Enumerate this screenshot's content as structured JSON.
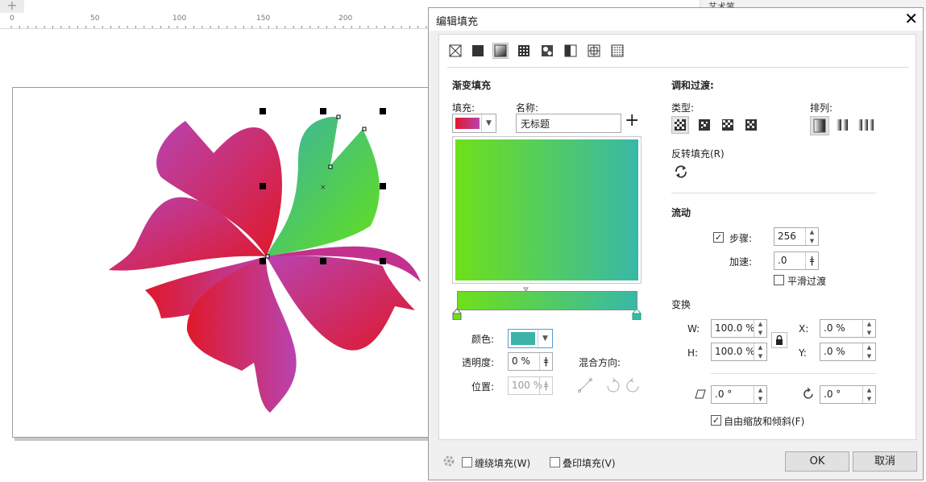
{
  "ruler": {
    "plus": "+",
    "ticks": [
      "0",
      "50",
      "100",
      "150",
      "200"
    ]
  },
  "right_strip": {
    "label": "艺术笔"
  },
  "dialog": {
    "title": "编辑填充",
    "close": "✕",
    "section_title": "渐变填充",
    "fill_label": "填充:",
    "name_label": "名称:",
    "name_value": "无标题",
    "add": "+",
    "blend_title": "调和过渡:",
    "type_label": "类型:",
    "arrange_label": "排列:",
    "reverse_label": "反转填充(R)",
    "flow_title": "流动",
    "steps_label": "步骤:",
    "steps_value": "256",
    "accel_label": "加速:",
    "accel_value": ".0",
    "smooth_label": "平滑过渡",
    "transform_title": "变换",
    "w_label": "W:",
    "w_value": "100.0 %",
    "h_label": "H:",
    "h_value": "100.0 %",
    "x_label": "X:",
    "x_value": ".0 %",
    "y_label": "Y:",
    "y_value": ".0 %",
    "skew_value": ".0 °",
    "rotate_value": ".0 °",
    "free_scale_label": "自由缩放和倾斜(F)",
    "color_label": "颜色:",
    "opacity_label": "透明度:",
    "opacity_value": "0 %",
    "position_label": "位置:",
    "position_value": "100 %",
    "blend_dir_label": "混合方向:",
    "wrap_fill_label": "缠绕填充(W)",
    "overprint_label": "叠印填充(V)",
    "ok": "OK",
    "cancel": "取消",
    "colors": {
      "start": "#6ee01a",
      "end": "#38b8a8",
      "swatch": "#3db3a8",
      "fill_a": "#e0182a",
      "fill_b": "#b843b0"
    }
  }
}
